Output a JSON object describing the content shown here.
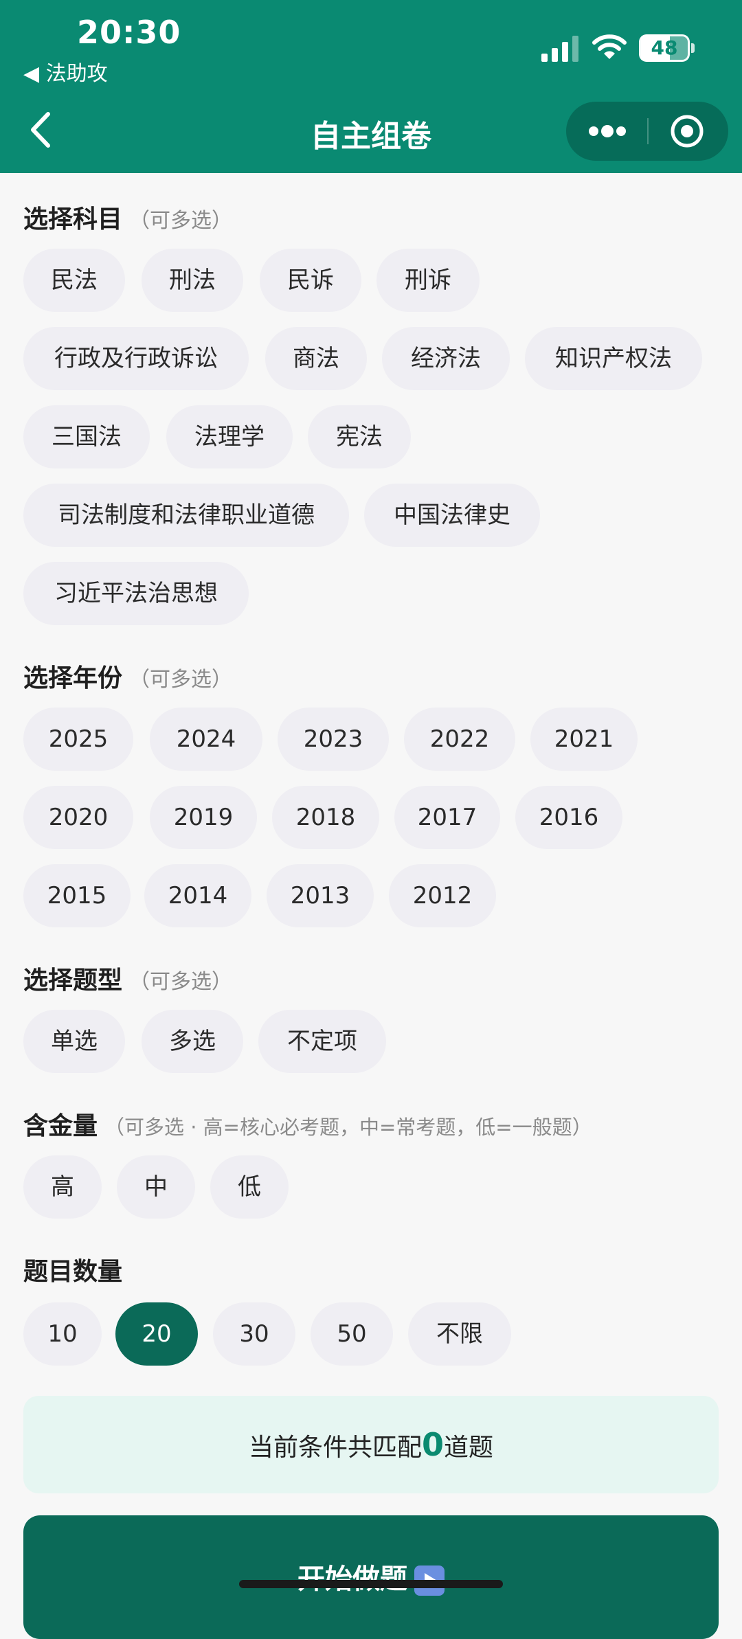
{
  "status_bar": {
    "time": "20:30",
    "back_app": "◀ 法助攻",
    "battery": "48"
  },
  "nav": {
    "title": "自主组卷"
  },
  "subjects": {
    "title": "选择科目",
    "hint": "（可多选）",
    "items": [
      "民法",
      "刑法",
      "民诉",
      "刑诉",
      "行政及行政诉讼",
      "商法",
      "经济法",
      "知识产权法",
      "三国法",
      "法理学",
      "宪法",
      "司法制度和法律职业道德",
      "中国法律史",
      "习近平法治思想"
    ]
  },
  "years": {
    "title": "选择年份",
    "hint": "（可多选）",
    "items": [
      "2025",
      "2024",
      "2023",
      "2022",
      "2021",
      "2020",
      "2019",
      "2018",
      "2017",
      "2016",
      "2015",
      "2014",
      "2013",
      "2012"
    ]
  },
  "question_types": {
    "title": "选择题型",
    "hint": "（可多选）",
    "items": [
      "单选",
      "多选",
      "不定项"
    ]
  },
  "value": {
    "title": "含金量",
    "hint": "（可多选 · 高=核心必考题，中=常考题，低=一般题）",
    "items": [
      "高",
      "中",
      "低"
    ]
  },
  "count": {
    "title": "题目数量",
    "items": [
      "10",
      "20",
      "30",
      "50",
      "不限"
    ],
    "selected": "20"
  },
  "match": {
    "prefix": "当前条件共匹配",
    "count": "0",
    "suffix": "道题"
  },
  "start_button": {
    "label": "开始做题"
  },
  "colors": {
    "primary": "#0a8a72",
    "selected_chip": "#0b6a58",
    "chip_bg": "#efeef3",
    "match_bg": "#e6f6f2"
  }
}
